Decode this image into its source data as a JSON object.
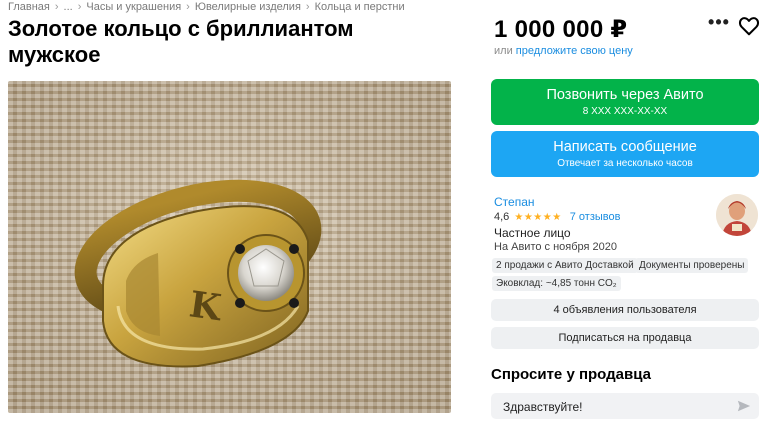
{
  "breadcrumbs": {
    "items": [
      "Главная",
      "...",
      "Часы и украшения",
      "Ювелирные изделия",
      "Кольца и перстни"
    ],
    "separator": "›"
  },
  "listing": {
    "title": "Золотое кольцо с бриллиантом мужское",
    "price": "1 000 000 ₽",
    "offer_prefix": "или",
    "offer_link": "предложите свою цену"
  },
  "actions": {
    "call_label": "Позвонить через Авито",
    "call_phone": "8 XXX XXX-XX-XX",
    "message_label": "Написать сообщение",
    "message_sub": "Отвечает за несколько часов",
    "more_icon": "more-dots-icon",
    "favorite_icon": "heart-icon"
  },
  "seller": {
    "name": "Степан",
    "rating": "4,6",
    "stars_icon": "★★★★★",
    "reviews": "7 отзывов",
    "type": "Частное лицо",
    "since": "На Авито с ноября 2020",
    "badges": [
      "2 продажи с Авито Доставкой",
      "Документы проверены",
      "Эковклад: ~4,85 тонн CO₂"
    ],
    "ads_button": "4 объявления пользователя",
    "subscribe_button": "Подписаться на продавца"
  },
  "ask": {
    "title": "Спросите у продавца",
    "input_value": "Здравствуйте!"
  },
  "colors": {
    "call_button": "#03b34a",
    "message_button": "#1da6f3",
    "link": "#1a8de0",
    "star": "#ffb021"
  }
}
